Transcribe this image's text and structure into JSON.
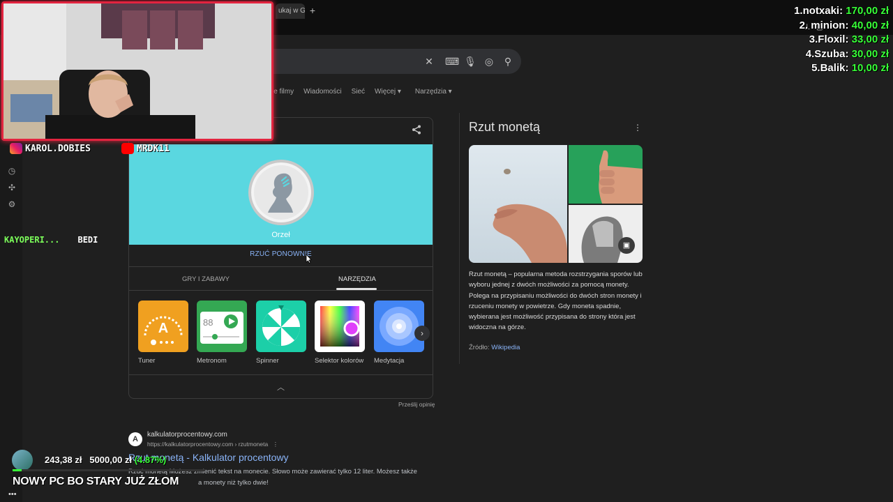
{
  "browser": {
    "tab_label": "ukaj w Go",
    "new_tab": "+"
  },
  "search": {
    "nav": [
      "kie filmy",
      "Wiadomości",
      "Sieć",
      "Więcej ▾",
      "Narzędzia ▾"
    ]
  },
  "coin_card": {
    "result_label": "Orzeł",
    "flip_again": "RZUĆ PONOWNIE",
    "tabs": [
      "GRY I ZABAWY",
      "NARZĘDZIA"
    ],
    "active_tab": "NARZĘDZIA",
    "tools": [
      {
        "name": "Tuner",
        "color": "#f0a020"
      },
      {
        "name": "Metronom",
        "color": "#34a853"
      },
      {
        "name": "Spinner",
        "color": "#1ccfa8"
      },
      {
        "name": "Selektor kolorów",
        "color": "#ffffff"
      },
      {
        "name": "Medytacja",
        "color": "#4285f4"
      }
    ],
    "feedback": "Prześlij opinię"
  },
  "knowledge_panel": {
    "title": "Rzut monetą",
    "description": "Rzut monetą – popularna metoda rozstrzygania sporów lub wyboru jednej z dwóch możliwości za pomocą monety. Polega na przypisaniu możliwości do dwóch stron monety i rzuceniu monety w powietrze. Gdy moneta spadnie, wybierana jest możliwość przypisana do strony która jest widoczna na górze.",
    "source_label": "Źródło:",
    "source_link": "Wikipedia"
  },
  "result": {
    "site": "kalkulatorprocentowy.com",
    "url": "https://kalkulatorprocentowy.com › rzutmoneta",
    "title": "Rzut monetą - Kalkulator procentowy",
    "snippet_1": "Rzuć monetą Możesz zmienić tekst na monecie. Słowo może zawierać tylko 12 liter. Możesz także",
    "snippet_2": "a monety niż tylko dwie!"
  },
  "overlay": {
    "instagram": "KAROL.DOBIES",
    "youtube": "MRDK11",
    "chat_names": {
      "a": "KAYOPERI...",
      "b": "BEDI"
    },
    "donors": [
      {
        "name": "1.notxaki:",
        "amount": "170,00 zł"
      },
      {
        "name": "2. minion:",
        "amount": "40,00 zł"
      },
      {
        "name": "3.Floxil:",
        "amount": "33,00 zł"
      },
      {
        "name": "4.Szuba:",
        "amount": "30,00 zł"
      },
      {
        "name": "5.Balik:",
        "amount": "10,00 zł"
      }
    ],
    "goal_current": "243,38 zł",
    "goal_target": "5000,00 zł",
    "goal_pct": "(4.87%)",
    "goal_fraction": 0.0487,
    "ticker": "NOWY PC BO STARY JUŻ ZŁOM",
    "accent": "#e2243f",
    "money_green": "#38ff38"
  }
}
